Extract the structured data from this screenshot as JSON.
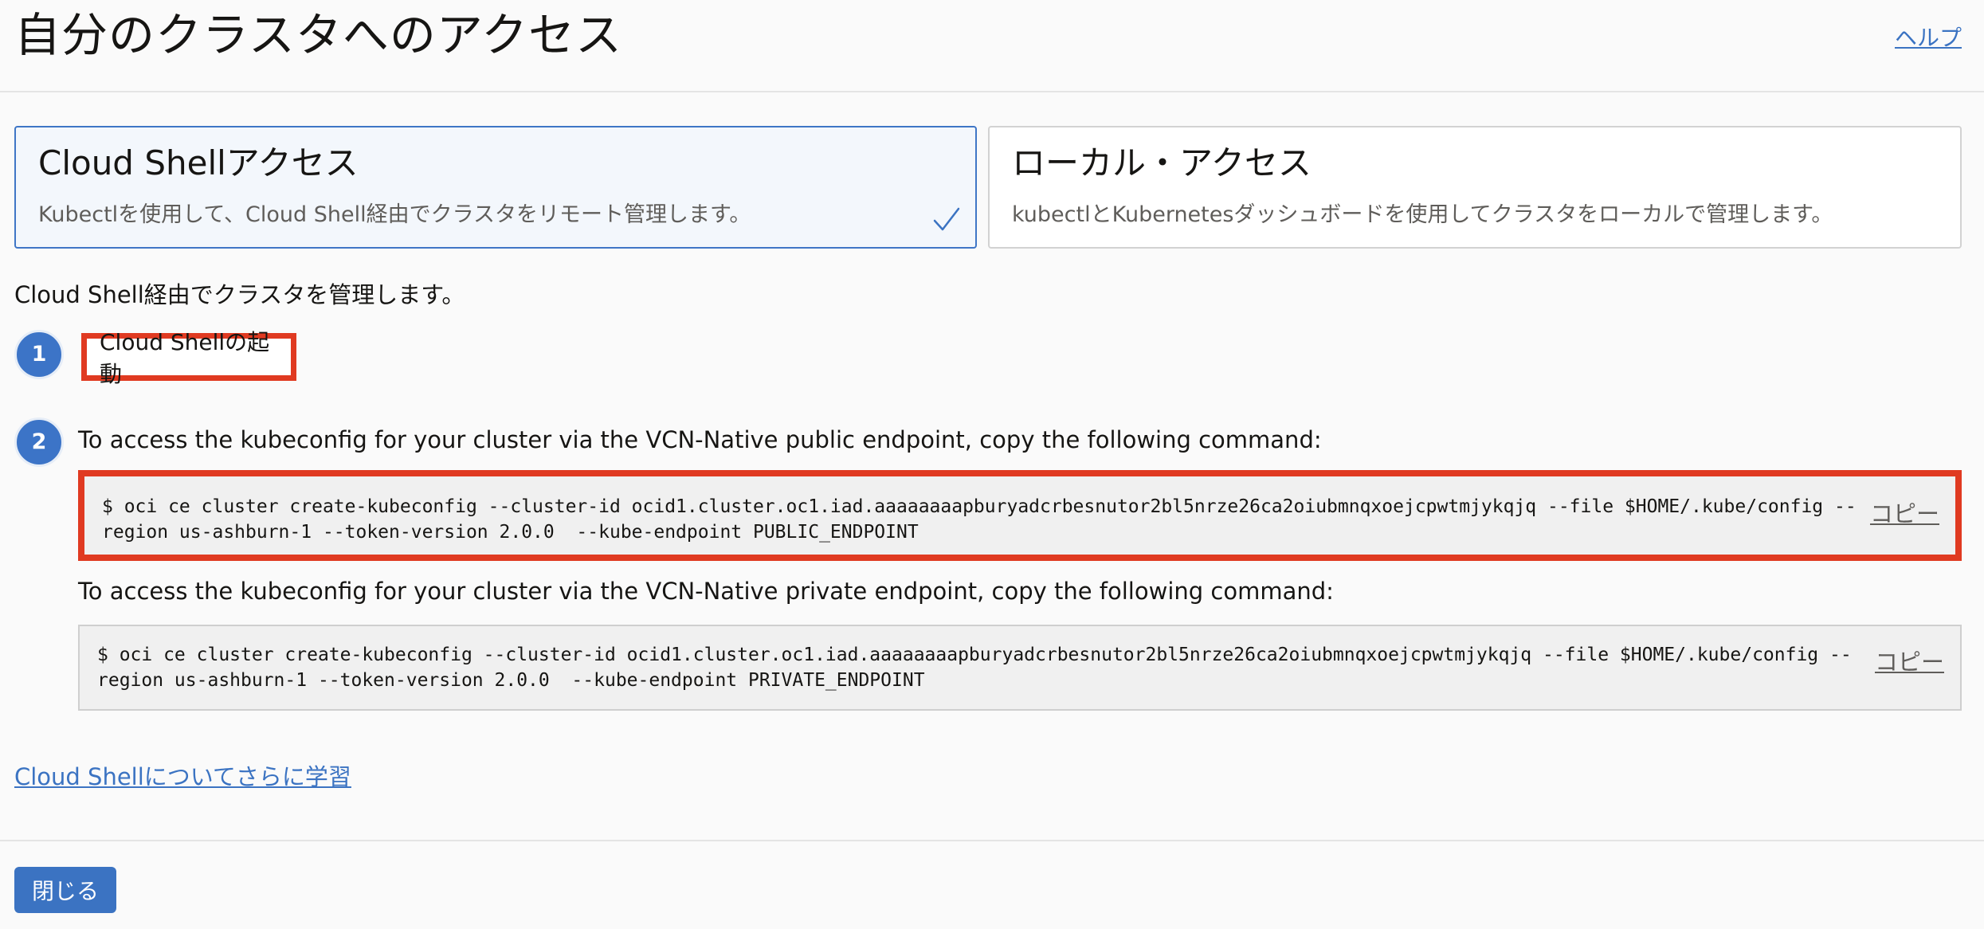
{
  "header": {
    "title": "自分のクラスタへのアクセス",
    "help_label": "ヘルプ"
  },
  "access_options": [
    {
      "title": "Cloud Shellアクセス",
      "description": "Kubectlを使用して、Cloud Shell経由でクラスタをリモート管理します。",
      "selected": true
    },
    {
      "title": "ローカル・アクセス",
      "description": "kubectlとKubernetesダッシュボードを使用してクラスタをローカルで管理します。",
      "selected": false
    }
  ],
  "intro": "Cloud Shell経由でクラスタを管理します。",
  "steps": [
    {
      "number": "1",
      "launch_label": "Cloud Shellの起動"
    },
    {
      "number": "2",
      "public_text": "To access the kubeconfig for your cluster via the VCN-Native public endpoint, copy the following command:",
      "public_command": "$ oci ce cluster create-kubeconfig --cluster-id ocid1.cluster.oc1.iad.aaaaaaaapburyadcrbesnutor2bl5nrze26ca2oiubmnqxoejcpwtmjykqjq --file $HOME/.kube/config --region us-ashburn-1 --token-version 2.0.0  --kube-endpoint PUBLIC_ENDPOINT",
      "private_text": "To access the kubeconfig for your cluster via the VCN-Native private endpoint, copy the following command:",
      "private_command": "$ oci ce cluster create-kubeconfig --cluster-id ocid1.cluster.oc1.iad.aaaaaaaapburyadcrbesnutor2bl5nrze26ca2oiubmnqxoejcpwtmjykqjq --file $HOME/.kube/config --region us-ashburn-1 --token-version 2.0.0  --kube-endpoint PRIVATE_ENDPOINT",
      "copy_label": "コピー"
    }
  ],
  "learn_more": "Cloud Shellについてさらに学習",
  "footer": {
    "close_label": "閉じる"
  },
  "colors": {
    "accent": "#3b73c2",
    "highlight": "#e03a21",
    "selected_bg": "#f3f7fc"
  },
  "icons": {
    "check": "check-icon"
  }
}
